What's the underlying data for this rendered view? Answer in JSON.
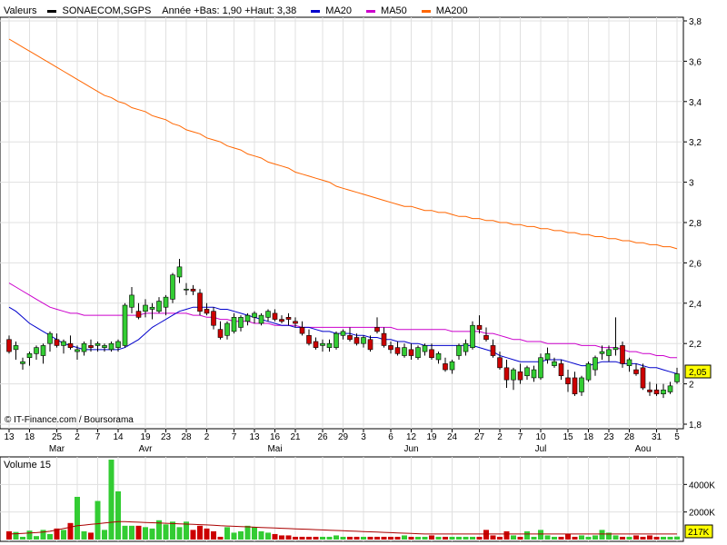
{
  "header": {
    "label": "Valeurs",
    "symbol": "SONAECOM,SGPS",
    "range_text": "Année +Bas: 1,90 +Haut: 3,38",
    "legend": [
      {
        "label": "MA20",
        "color": "#0000cc"
      },
      {
        "label": "MA50",
        "color": "#cc00cc"
      },
      {
        "label": "MA200",
        "color": "#ff6600"
      }
    ]
  },
  "credit": "© IT-Finance.com / Boursorama",
  "colors": {
    "up_candle": "#33cc33",
    "down_candle": "#cc0000",
    "ma20": "#0000cc",
    "ma50": "#cc00cc",
    "ma200": "#ff6600",
    "volume_avg": "#aa0000",
    "last_price_box": "#ffff00"
  },
  "chart_data": [
    {
      "type": "candlestick",
      "title": "SONAECOM,SGPS",
      "ylim": [
        1.8,
        3.8
      ],
      "y_ticks": [
        "3,8",
        "3,6",
        "3,4",
        "3,2",
        "3",
        "2,8",
        "2,6",
        "2,4",
        "2,2",
        "2",
        "1,8"
      ],
      "x_tick_labels": [
        "13",
        "18",
        "25",
        "2",
        "7",
        "14",
        "19",
        "23",
        "28",
        "2",
        "7",
        "13",
        "16",
        "21",
        "26",
        "29",
        "3",
        "6",
        "12",
        "19",
        "24",
        "27",
        "2",
        "7",
        "10",
        "15",
        "18",
        "23",
        "28",
        "31",
        "5"
      ],
      "month_labels": [
        "Mar",
        "Avr",
        "Mai",
        "Jun",
        "Jul",
        "Aou"
      ],
      "last_price": "2,05",
      "ohlc": [
        [
          2.22,
          2.24,
          2.15,
          2.16
        ],
        [
          2.17,
          2.21,
          2.12,
          2.19
        ],
        [
          2.1,
          2.13,
          2.07,
          2.11
        ],
        [
          2.13,
          2.16,
          2.09,
          2.15
        ],
        [
          2.15,
          2.19,
          2.12,
          2.18
        ],
        [
          2.14,
          2.2,
          2.1,
          2.19
        ],
        [
          2.2,
          2.26,
          2.16,
          2.25
        ],
        [
          2.22,
          2.25,
          2.18,
          2.19
        ],
        [
          2.19,
          2.22,
          2.15,
          2.21
        ],
        [
          2.2,
          2.24,
          2.17,
          2.18
        ],
        [
          2.16,
          2.19,
          2.12,
          2.17
        ],
        [
          2.16,
          2.21,
          2.14,
          2.2
        ],
        [
          2.19,
          2.22,
          2.16,
          2.18
        ],
        [
          2.19,
          2.21,
          2.16,
          2.2
        ],
        [
          2.18,
          2.2,
          2.16,
          2.19
        ],
        [
          2.17,
          2.21,
          2.16,
          2.2
        ],
        [
          2.18,
          2.22,
          2.16,
          2.21
        ],
        [
          2.19,
          2.4,
          2.18,
          2.39
        ],
        [
          2.38,
          2.48,
          2.35,
          2.44
        ],
        [
          2.36,
          2.4,
          2.32,
          2.33
        ],
        [
          2.36,
          2.42,
          2.33,
          2.39
        ],
        [
          2.37,
          2.4,
          2.32,
          2.38
        ],
        [
          2.36,
          2.43,
          2.35,
          2.41
        ],
        [
          2.38,
          2.44,
          2.34,
          2.43
        ],
        [
          2.42,
          2.55,
          2.4,
          2.54
        ],
        [
          2.53,
          2.62,
          2.5,
          2.58
        ],
        [
          2.47,
          2.5,
          2.44,
          2.47
        ],
        [
          2.47,
          2.49,
          2.44,
          2.46
        ],
        [
          2.45,
          2.47,
          2.34,
          2.36
        ],
        [
          2.37,
          2.4,
          2.34,
          2.35
        ],
        [
          2.36,
          2.38,
          2.27,
          2.29
        ],
        [
          2.27,
          2.31,
          2.22,
          2.23
        ],
        [
          2.24,
          2.31,
          2.22,
          2.3
        ],
        [
          2.26,
          2.35,
          2.25,
          2.33
        ],
        [
          2.28,
          2.34,
          2.26,
          2.33
        ],
        [
          2.31,
          2.35,
          2.29,
          2.34
        ],
        [
          2.33,
          2.36,
          2.3,
          2.35
        ],
        [
          2.3,
          2.35,
          2.29,
          2.34
        ],
        [
          2.33,
          2.37,
          2.31,
          2.36
        ],
        [
          2.35,
          2.37,
          2.31,
          2.32
        ],
        [
          2.32,
          2.34,
          2.3,
          2.31
        ],
        [
          2.33,
          2.35,
          2.29,
          2.32
        ],
        [
          2.31,
          2.33,
          2.28,
          2.3
        ],
        [
          2.28,
          2.31,
          2.24,
          2.25
        ],
        [
          2.24,
          2.27,
          2.19,
          2.2
        ],
        [
          2.21,
          2.23,
          2.17,
          2.18
        ],
        [
          2.19,
          2.22,
          2.16,
          2.2
        ],
        [
          2.18,
          2.22,
          2.16,
          2.2
        ],
        [
          2.18,
          2.26,
          2.17,
          2.25
        ],
        [
          2.24,
          2.27,
          2.22,
          2.26
        ],
        [
          2.24,
          2.28,
          2.21,
          2.22
        ],
        [
          2.23,
          2.25,
          2.19,
          2.2
        ],
        [
          2.2,
          2.24,
          2.18,
          2.23
        ],
        [
          2.22,
          2.24,
          2.16,
          2.17
        ],
        [
          2.28,
          2.33,
          2.25,
          2.26
        ],
        [
          2.25,
          2.28,
          2.18,
          2.19
        ],
        [
          2.19,
          2.21,
          2.15,
          2.17
        ],
        [
          2.18,
          2.21,
          2.14,
          2.15
        ],
        [
          2.14,
          2.2,
          2.13,
          2.18
        ],
        [
          2.17,
          2.2,
          2.12,
          2.14
        ],
        [
          2.13,
          2.19,
          2.12,
          2.18
        ],
        [
          2.16,
          2.2,
          2.14,
          2.19
        ],
        [
          2.17,
          2.2,
          2.12,
          2.13
        ],
        [
          2.12,
          2.16,
          2.1,
          2.15
        ],
        [
          2.1,
          2.13,
          2.06,
          2.07
        ],
        [
          2.07,
          2.12,
          2.05,
          2.11
        ],
        [
          2.14,
          2.2,
          2.12,
          2.19
        ],
        [
          2.16,
          2.22,
          2.14,
          2.2
        ],
        [
          2.18,
          2.31,
          2.17,
          2.29
        ],
        [
          2.29,
          2.34,
          2.25,
          2.27
        ],
        [
          2.24,
          2.28,
          2.21,
          2.22
        ],
        [
          2.19,
          2.22,
          2.13,
          2.14
        ],
        [
          2.13,
          2.16,
          2.07,
          2.08
        ],
        [
          2.08,
          2.12,
          1.98,
          2.02
        ],
        [
          2.02,
          2.08,
          1.97,
          2.07
        ],
        [
          2.06,
          2.1,
          2.0,
          2.02
        ],
        [
          2.04,
          2.09,
          2.02,
          2.08
        ],
        [
          2.03,
          2.09,
          2.01,
          2.07
        ],
        [
          2.03,
          2.15,
          2.02,
          2.13
        ],
        [
          2.12,
          2.18,
          2.1,
          2.15
        ],
        [
          2.09,
          2.13,
          2.08,
          2.11
        ],
        [
          2.1,
          2.12,
          2.02,
          2.04
        ],
        [
          2.03,
          2.07,
          1.96,
          2.0
        ],
        [
          2.03,
          2.06,
          1.94,
          1.95
        ],
        [
          1.96,
          2.04,
          1.94,
          2.03
        ],
        [
          2.02,
          2.11,
          2.01,
          2.1
        ],
        [
          2.07,
          2.14,
          2.04,
          2.13
        ],
        [
          2.15,
          2.19,
          2.12,
          2.16
        ],
        [
          2.14,
          2.19,
          2.11,
          2.17
        ],
        [
          2.17,
          2.33,
          2.14,
          2.18
        ],
        [
          2.19,
          2.21,
          2.08,
          2.1
        ],
        [
          2.09,
          2.13,
          2.06,
          2.12
        ],
        [
          2.07,
          2.1,
          2.04,
          2.05
        ],
        [
          2.08,
          2.1,
          1.97,
          1.98
        ],
        [
          1.97,
          2.01,
          1.94,
          1.96
        ],
        [
          1.97,
          2.0,
          1.94,
          1.95
        ],
        [
          1.95,
          2.0,
          1.93,
          1.97
        ],
        [
          1.96,
          2.01,
          1.95,
          1.99
        ],
        [
          2.01,
          2.08,
          2.0,
          2.05
        ]
      ],
      "ma20": [
        2.38,
        2.36,
        2.33,
        2.3,
        2.28,
        2.26,
        2.24,
        2.22,
        2.2,
        2.19,
        2.18,
        2.17,
        2.17,
        2.17,
        2.17,
        2.17,
        2.17,
        2.18,
        2.2,
        2.22,
        2.25,
        2.28,
        2.3,
        2.32,
        2.34,
        2.36,
        2.37,
        2.38,
        2.38,
        2.38,
        2.38,
        2.37,
        2.37,
        2.36,
        2.35,
        2.34,
        2.33,
        2.32,
        2.31,
        2.3,
        2.29,
        2.29,
        2.28,
        2.28,
        2.28,
        2.27,
        2.26,
        2.26,
        2.25,
        2.25,
        2.25,
        2.24,
        2.24,
        2.23,
        2.23,
        2.22,
        2.22,
        2.21,
        2.21,
        2.2,
        2.2,
        2.19,
        2.19,
        2.19,
        2.19,
        2.19,
        2.19,
        2.19,
        2.19,
        2.18,
        2.17,
        2.16,
        2.14,
        2.13,
        2.12,
        2.11,
        2.11,
        2.11,
        2.11,
        2.12,
        2.12,
        2.12,
        2.11,
        2.1,
        2.09,
        2.09,
        2.1,
        2.11,
        2.11,
        2.11,
        2.1,
        2.1,
        2.1,
        2.09,
        2.08,
        2.08,
        2.07,
        2.06,
        2.05
      ],
      "ma50": [
        2.5,
        2.48,
        2.46,
        2.44,
        2.42,
        2.4,
        2.38,
        2.37,
        2.36,
        2.35,
        2.35,
        2.34,
        2.34,
        2.34,
        2.34,
        2.34,
        2.34,
        2.34,
        2.34,
        2.34,
        2.35,
        2.35,
        2.35,
        2.35,
        2.35,
        2.35,
        2.35,
        2.34,
        2.34,
        2.33,
        2.33,
        2.32,
        2.32,
        2.31,
        2.31,
        2.31,
        2.3,
        2.3,
        2.3,
        2.29,
        2.29,
        2.29,
        2.29,
        2.28,
        2.28,
        2.28,
        2.28,
        2.28,
        2.28,
        2.28,
        2.28,
        2.28,
        2.28,
        2.28,
        2.28,
        2.28,
        2.28,
        2.27,
        2.27,
        2.27,
        2.27,
        2.27,
        2.27,
        2.27,
        2.27,
        2.26,
        2.26,
        2.26,
        2.26,
        2.26,
        2.25,
        2.25,
        2.24,
        2.23,
        2.22,
        2.22,
        2.21,
        2.21,
        2.21,
        2.2,
        2.2,
        2.2,
        2.2,
        2.2,
        2.19,
        2.19,
        2.19,
        2.18,
        2.18,
        2.18,
        2.17,
        2.16,
        2.16,
        2.15,
        2.15,
        2.14,
        2.14,
        2.13,
        2.13
      ],
      "ma200": [
        3.71,
        3.69,
        3.67,
        3.65,
        3.63,
        3.61,
        3.59,
        3.57,
        3.55,
        3.53,
        3.51,
        3.49,
        3.47,
        3.45,
        3.43,
        3.42,
        3.4,
        3.39,
        3.37,
        3.36,
        3.35,
        3.33,
        3.32,
        3.31,
        3.29,
        3.28,
        3.26,
        3.25,
        3.24,
        3.22,
        3.21,
        3.2,
        3.18,
        3.17,
        3.16,
        3.14,
        3.13,
        3.12,
        3.1,
        3.09,
        3.08,
        3.07,
        3.05,
        3.04,
        3.03,
        3.02,
        3.01,
        3.0,
        2.98,
        2.97,
        2.96,
        2.95,
        2.94,
        2.93,
        2.92,
        2.91,
        2.9,
        2.89,
        2.88,
        2.88,
        2.87,
        2.86,
        2.86,
        2.85,
        2.85,
        2.84,
        2.83,
        2.83,
        2.82,
        2.82,
        2.81,
        2.81,
        2.8,
        2.8,
        2.79,
        2.79,
        2.78,
        2.78,
        2.77,
        2.77,
        2.76,
        2.76,
        2.75,
        2.75,
        2.74,
        2.74,
        2.73,
        2.73,
        2.72,
        2.72,
        2.71,
        2.71,
        2.7,
        2.7,
        2.69,
        2.69,
        2.68,
        2.68,
        2.67
      ]
    },
    {
      "type": "bar",
      "title": "Volume 15",
      "ylim": [
        0,
        6000
      ],
      "y_ticks": [
        "4000K",
        "2000K"
      ],
      "last_value": "217K",
      "values": [
        600,
        550,
        200,
        650,
        250,
        700,
        400,
        800,
        700,
        1200,
        3100,
        600,
        500,
        2800,
        700,
        5800,
        3500,
        1000,
        1000,
        1000,
        900,
        800,
        1400,
        1100,
        1300,
        900,
        1300,
        700,
        1000,
        800,
        600,
        200,
        900,
        500,
        600,
        1000,
        900,
        600,
        500,
        400,
        300,
        300,
        200,
        200,
        200,
        200,
        200,
        200,
        300,
        200,
        200,
        200,
        200,
        200,
        200,
        200,
        200,
        200,
        300,
        200,
        200,
        200,
        300,
        200,
        200,
        200,
        200,
        200,
        200,
        200,
        700,
        300,
        200,
        600,
        300,
        200,
        600,
        200,
        700,
        300,
        200,
        200,
        400,
        200,
        300,
        200,
        300,
        700,
        500,
        300,
        200,
        200,
        300,
        200,
        300,
        200,
        200,
        200,
        217
      ],
      "avg_values": [
        400,
        420,
        450,
        480,
        500,
        550,
        600,
        700,
        800,
        900,
        1000,
        1050,
        1100,
        1150,
        1200,
        1250,
        1300,
        1300,
        1280,
        1260,
        1240,
        1220,
        1200,
        1180,
        1160,
        1140,
        1120,
        1100,
        1080,
        1060,
        1040,
        1000,
        980,
        960,
        940,
        920,
        900,
        880,
        860,
        840,
        820,
        800,
        780,
        760,
        740,
        720,
        700,
        680,
        660,
        640,
        620,
        600,
        580,
        560,
        540,
        520,
        500,
        480,
        460,
        440,
        420,
        400,
        400,
        400,
        400,
        400,
        400,
        400,
        400,
        400,
        400,
        400,
        400,
        400,
        400,
        400,
        400,
        400,
        400,
        400,
        400,
        400,
        400,
        400,
        400,
        400,
        400,
        400,
        400,
        400,
        400,
        400,
        400,
        400,
        400,
        400,
        400,
        400,
        400
      ]
    }
  ]
}
